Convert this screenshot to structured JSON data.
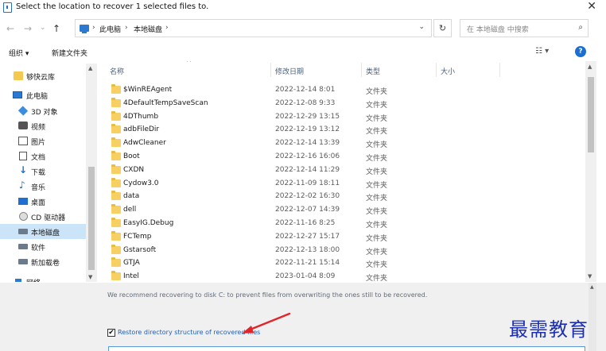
{
  "window": {
    "title": "Select the location to recover 1 selected files to.",
    "close_glyph": "✕"
  },
  "nav": {
    "back": "←",
    "forward": "→",
    "history": "⌄",
    "up": "↑",
    "path": [
      "此电脑",
      "本地磁盘"
    ],
    "separator": "›",
    "dropdown": "⌄",
    "refresh": "↻",
    "search_placeholder": "在 本地磁盘 中搜索",
    "search_icon": "⌕"
  },
  "toolbar": {
    "organize": "组织 ▾",
    "new_folder": "新建文件夹",
    "views": "☷ ▾",
    "help": "?"
  },
  "sidebar": {
    "items": [
      {
        "label": "够快云库",
        "icon": "folder-icon"
      },
      {
        "label": "此电脑",
        "icon": "computer-icon"
      },
      {
        "label": "3D 对象",
        "icon": "3d-objects-icon"
      },
      {
        "label": "视频",
        "icon": "video-icon"
      },
      {
        "label": "图片",
        "icon": "pictures-icon"
      },
      {
        "label": "文档",
        "icon": "documents-icon"
      },
      {
        "label": "下载",
        "icon": "download-icon"
      },
      {
        "label": "音乐",
        "icon": "music-icon"
      },
      {
        "label": "桌面",
        "icon": "desktop-icon"
      },
      {
        "label": "CD 驱动器",
        "icon": "cd-drive-icon"
      },
      {
        "label": "本地磁盘",
        "icon": "disk-icon"
      },
      {
        "label": "软件",
        "icon": "disk-icon"
      },
      {
        "label": "新加载卷",
        "icon": "disk-icon"
      },
      {
        "label": "网络",
        "icon": "network-icon"
      }
    ],
    "selected_index": 10
  },
  "columns": {
    "name": "名称",
    "date": "修改日期",
    "type": "类型",
    "size": "大小",
    "sort_caret": "^"
  },
  "files": [
    {
      "name": "$WinREAgent",
      "date": "2022-12-14 8:01",
      "type": "文件夹"
    },
    {
      "name": "4DefaultTempSaveScan",
      "date": "2022-12-08 9:33",
      "type": "文件夹"
    },
    {
      "name": "4DThumb",
      "date": "2022-12-29 13:15",
      "type": "文件夹"
    },
    {
      "name": "adbFileDir",
      "date": "2022-12-19 13:12",
      "type": "文件夹"
    },
    {
      "name": "AdwCleaner",
      "date": "2022-12-14 13:39",
      "type": "文件夹"
    },
    {
      "name": "Boot",
      "date": "2022-12-16 16:06",
      "type": "文件夹"
    },
    {
      "name": "CXDN",
      "date": "2022-12-14 11:29",
      "type": "文件夹"
    },
    {
      "name": "Cydow3.0",
      "date": "2022-11-09 18:11",
      "type": "文件夹"
    },
    {
      "name": "data",
      "date": "2022-12-02 16:30",
      "type": "文件夹"
    },
    {
      "name": "dell",
      "date": "2022-12-07 14:39",
      "type": "文件夹"
    },
    {
      "name": "EasyIG.Debug",
      "date": "2022-11-16 8:25",
      "type": "文件夹"
    },
    {
      "name": "FCTemp",
      "date": "2022-12-27 15:17",
      "type": "文件夹"
    },
    {
      "name": "Gstarsoft",
      "date": "2022-12-13 18:00",
      "type": "文件夹"
    },
    {
      "name": "GTJA",
      "date": "2022-11-21 15:14",
      "type": "文件夹"
    },
    {
      "name": "Intel",
      "date": "2023-01-04 8:09",
      "type": "文件夹"
    }
  ],
  "bottom": {
    "recommend": "We recommend recovering to disk C: to prevent files from overwriting the ones still to be recovered.",
    "restore_label": "Restore directory structure of recovered files",
    "restore_checked": true,
    "check_glyph": "✔"
  },
  "scroll": {
    "up": "▲",
    "down": "▼"
  },
  "watermark": "最需教育",
  "colors": {
    "accent": "#1c6ed1",
    "selection": "#cce4f7",
    "folder": "#f7d063",
    "annotation_arrow": "#e0262a",
    "watermark": "#1d2fb0"
  }
}
